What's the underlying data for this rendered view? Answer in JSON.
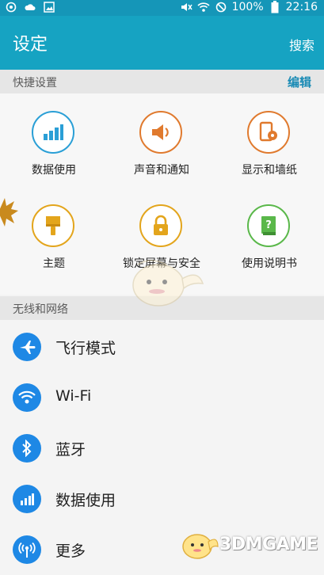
{
  "status_bar": {
    "battery": "100%",
    "time": "22:16",
    "left_icons": [
      "notification-icon",
      "weather-icon",
      "gallery-icon"
    ],
    "right_icons": [
      "mute-icon",
      "wifi-icon",
      "block-icon",
      "battery-icon"
    ]
  },
  "app_bar": {
    "title": "设定",
    "action": "搜索"
  },
  "quick_settings": {
    "header": "快捷设置",
    "edit": "编辑",
    "tiles": [
      {
        "label": "数据使用",
        "icon": "data-usage-icon",
        "color": "#2a9fd6"
      },
      {
        "label": "声音和通知",
        "icon": "sound-icon",
        "color": "#e07a2e"
      },
      {
        "label": "显示和墙纸",
        "icon": "display-icon",
        "color": "#e07a2e"
      },
      {
        "label": "主题",
        "icon": "theme-brush-icon",
        "color": "#e3a51c"
      },
      {
        "label": "锁定屏幕与安全",
        "icon": "lock-icon",
        "color": "#e3a51c"
      },
      {
        "label": "使用说明书",
        "icon": "help-book-icon",
        "color": "#5ab84a"
      }
    ]
  },
  "wireless": {
    "header": "无线和网络",
    "items": [
      {
        "label": "飞行模式",
        "icon": "airplane-icon"
      },
      {
        "label": "Wi-Fi",
        "icon": "wifi-icon"
      },
      {
        "label": "蓝牙",
        "icon": "bluetooth-icon"
      },
      {
        "label": "数据使用",
        "icon": "data-usage-icon"
      },
      {
        "label": "更多",
        "icon": "more-connections-icon"
      }
    ]
  },
  "colors": {
    "app_bar": "#16a3c2",
    "status_bar": "#1596b8",
    "accent": "#1a8bb5",
    "list_icon": "#1e88e5"
  },
  "watermark": {
    "text": "3DMGAME"
  }
}
